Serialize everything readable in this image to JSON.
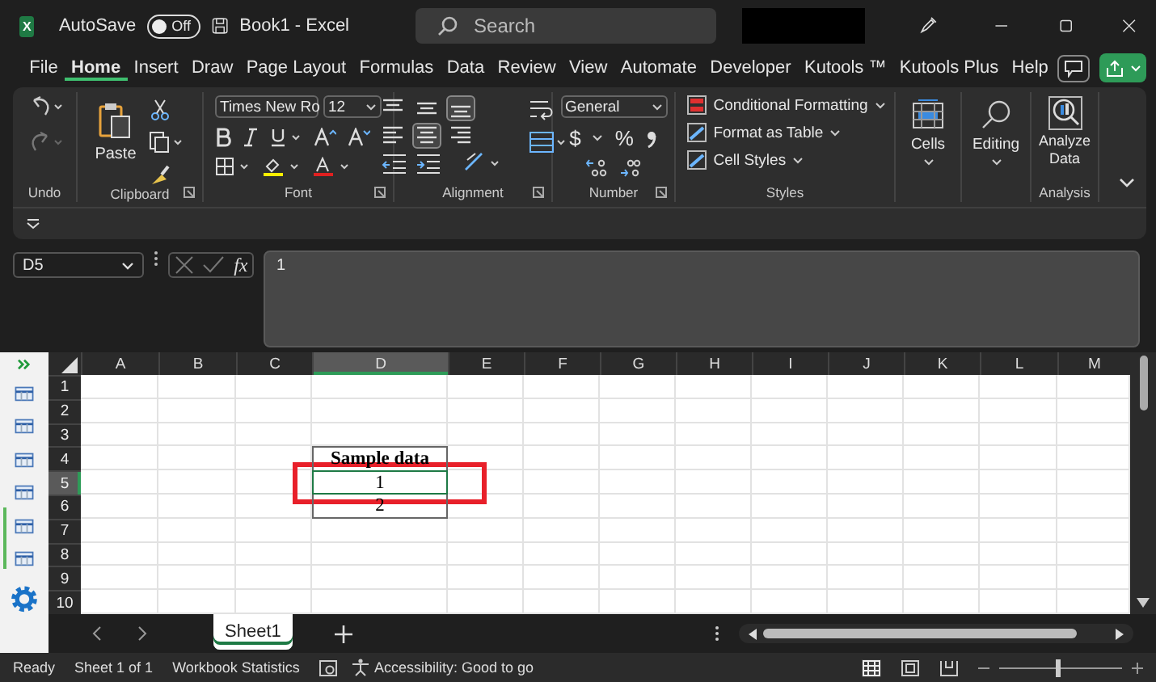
{
  "title_bar": {
    "app_logo": "X",
    "autosave_label": "AutoSave",
    "autosave": {
      "on": false,
      "label": "Off"
    },
    "document_title": "Book1  -  Excel",
    "search": {
      "placeholder": "Search"
    }
  },
  "menu_tabs": [
    {
      "label": "File",
      "selected": false
    },
    {
      "label": "Home",
      "selected": true
    },
    {
      "label": "Insert",
      "selected": false
    },
    {
      "label": "Draw",
      "selected": false
    },
    {
      "label": "Page Layout",
      "selected": false
    },
    {
      "label": "Formulas",
      "selected": false
    },
    {
      "label": "Data",
      "selected": false
    },
    {
      "label": "Review",
      "selected": false
    },
    {
      "label": "View",
      "selected": false
    },
    {
      "label": "Automate",
      "selected": false
    },
    {
      "label": "Developer",
      "selected": false
    },
    {
      "label": "Kutools ™",
      "selected": false
    },
    {
      "label": "Kutools Plus",
      "selected": false
    },
    {
      "label": "Help",
      "selected": false
    }
  ],
  "ribbon": {
    "undo_group": {
      "label": "Undo"
    },
    "clipboard_group": {
      "label": "Clipboard",
      "paste": "Paste"
    },
    "font_group": {
      "label": "Font",
      "font_name": "Times New Ro",
      "font_size": "12"
    },
    "alignment_group": {
      "label": "Alignment",
      "buttons": [
        {
          "kind": "top",
          "selected": false
        },
        {
          "kind": "middle",
          "selected": false
        },
        {
          "kind": "bottom",
          "selected": true
        },
        {
          "kind": "left",
          "selected": false
        },
        {
          "kind": "center",
          "selected": true
        },
        {
          "kind": "right",
          "selected": false
        }
      ]
    },
    "number_group": {
      "label": "Number",
      "format": "General",
      "currency": "$",
      "percent": "%"
    },
    "styles_group": {
      "label": "Styles",
      "items": [
        "Conditional Formatting",
        "Format as Table",
        "Cell Styles"
      ]
    },
    "cells_button": "Cells",
    "editing_button": "Editing",
    "analysis_group": {
      "label": "Analysis",
      "button": "Analyze Data"
    }
  },
  "formula_bar": {
    "name_box": "D5",
    "fx": "fx",
    "value": "1"
  },
  "sheet": {
    "columns": [
      {
        "label": "A",
        "selected": false
      },
      {
        "label": "B",
        "selected": false
      },
      {
        "label": "C",
        "selected": false
      },
      {
        "label": "D",
        "selected": true
      },
      {
        "label": "E",
        "selected": false
      },
      {
        "label": "F",
        "selected": false
      },
      {
        "label": "G",
        "selected": false
      },
      {
        "label": "H",
        "selected": false
      },
      {
        "label": "I",
        "selected": false
      },
      {
        "label": "J",
        "selected": false
      },
      {
        "label": "K",
        "selected": false
      },
      {
        "label": "L",
        "selected": false
      },
      {
        "label": "M",
        "selected": false
      }
    ],
    "rows": [
      {
        "label": "1",
        "selected": false
      },
      {
        "label": "2",
        "selected": false
      },
      {
        "label": "3",
        "selected": false
      },
      {
        "label": "4",
        "selected": false
      },
      {
        "label": "5",
        "selected": true
      },
      {
        "label": "6",
        "selected": false
      },
      {
        "label": "7",
        "selected": false
      },
      {
        "label": "8",
        "selected": false
      },
      {
        "label": "9",
        "selected": false
      },
      {
        "label": "10",
        "selected": false
      }
    ],
    "data_cells": [
      {
        "value": "Sample data",
        "selected": false
      },
      {
        "value": "1",
        "selected": true
      },
      {
        "value": "2",
        "selected": false
      }
    ]
  },
  "sheet_tabs": [
    {
      "label": "Sheet1",
      "selected": true
    }
  ],
  "status_bar": {
    "ready": "Ready",
    "sheet_info": "Sheet 1 of 1",
    "workbook_statistics": "Workbook Statistics",
    "accessibility": "Accessibility: Good to go",
    "zoom": {
      "level": 0.47
    }
  }
}
